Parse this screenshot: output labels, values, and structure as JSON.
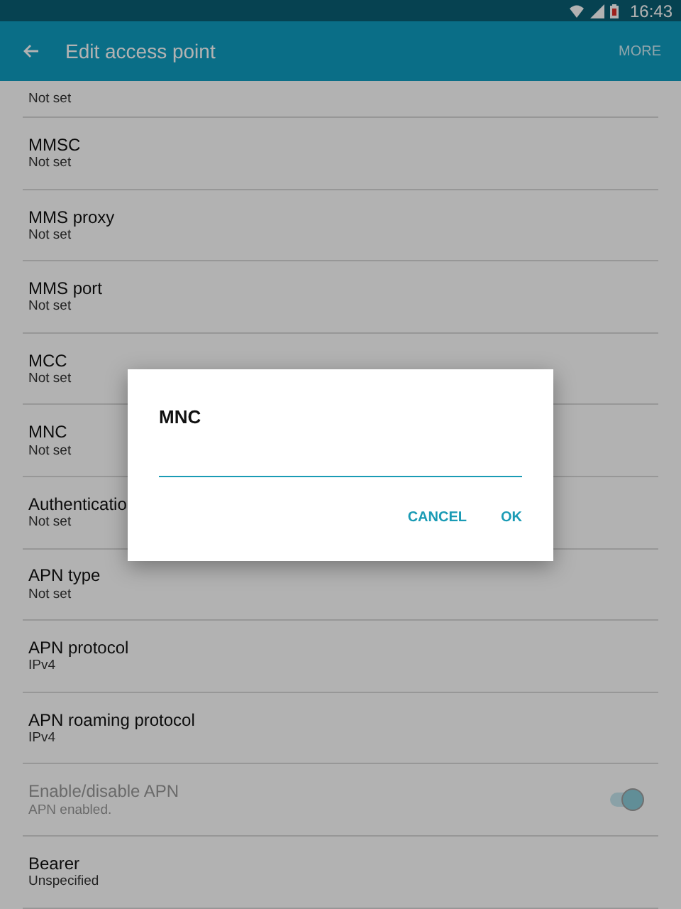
{
  "status_bar": {
    "time": "16:43"
  },
  "app_bar": {
    "title": "Edit access point",
    "menu": "MORE"
  },
  "settings": [
    {
      "kind": "partial",
      "subtitle": "Not set",
      "disabled": false
    },
    {
      "kind": "text",
      "title": "MMSC",
      "subtitle": "Not set",
      "disabled": false
    },
    {
      "kind": "text",
      "title": "MMS proxy",
      "subtitle": "Not set",
      "disabled": false
    },
    {
      "kind": "text",
      "title": "MMS port",
      "subtitle": "Not set",
      "disabled": false
    },
    {
      "kind": "text",
      "title": "MCC",
      "subtitle": "Not set",
      "disabled": false
    },
    {
      "kind": "text",
      "title": "MNC",
      "subtitle": "Not set",
      "disabled": false
    },
    {
      "kind": "text",
      "title": "Authenticatio",
      "subtitle": "Not set",
      "disabled": false
    },
    {
      "kind": "text",
      "title": "APN type",
      "subtitle": "Not set",
      "disabled": false
    },
    {
      "kind": "text",
      "title": "APN protocol",
      "subtitle": "IPv4",
      "disabled": false
    },
    {
      "kind": "text",
      "title": "APN roaming protocol",
      "subtitle": "IPv4",
      "disabled": false
    },
    {
      "kind": "switch",
      "title": "Enable/disable APN",
      "subtitle": "APN enabled.",
      "disabled": true,
      "on": true
    },
    {
      "kind": "text",
      "title": "Bearer",
      "subtitle": "Unspecified",
      "disabled": false
    }
  ],
  "dialog": {
    "title": "MNC",
    "buttons": [
      "CANCEL",
      "OK"
    ]
  }
}
